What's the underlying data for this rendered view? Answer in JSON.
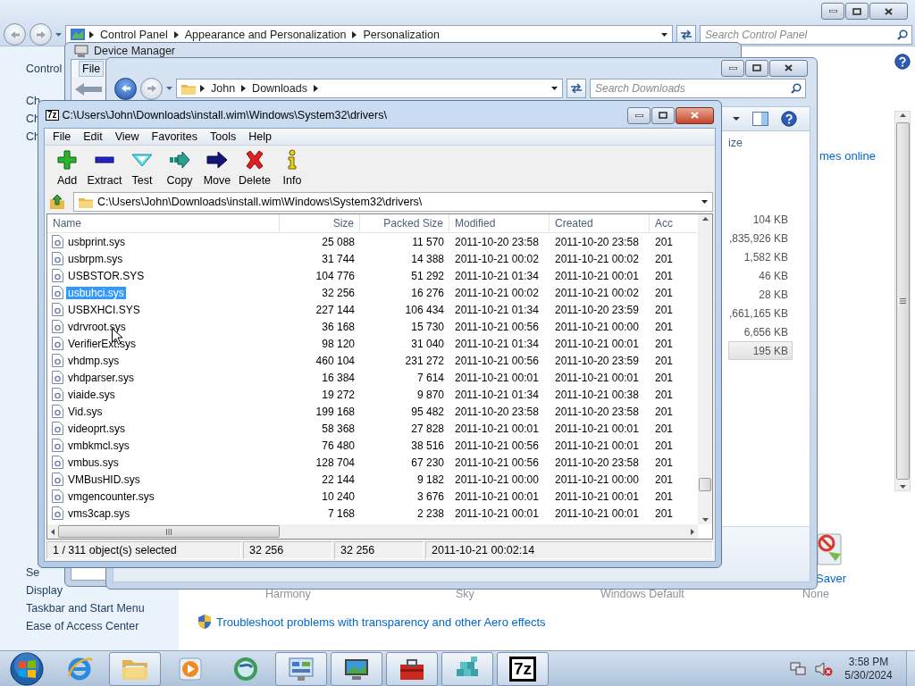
{
  "control_panel": {
    "breadcrumbs": [
      "Control Panel",
      "Appearance and Personalization",
      "Personalization"
    ],
    "search_placeholder": "Search Control Panel",
    "sidebar_top": [
      "Control",
      "Ch",
      "Ch",
      "Ch"
    ],
    "sidebar_bottom": [
      "Se",
      "Display",
      "Taskbar and Start Menu",
      "Ease of Access Center"
    ],
    "online_link": "mes online",
    "saver_label": "Saver",
    "theme_names": [
      "Harmony",
      "Sky",
      "Windows Default",
      "None"
    ],
    "troubleshoot_link": "Troubleshoot problems with transparency and other Aero effects"
  },
  "device_manager": {
    "title": "Device Manager",
    "menu": [
      "File"
    ]
  },
  "downloads": {
    "breadcrumbs": [
      "John",
      "Downloads"
    ],
    "search_placeholder": "Search Downloads",
    "column": "ize",
    "sizes": [
      {
        "text": "104 KB",
        "selected": false
      },
      {
        "text": ",835,926 KB",
        "selected": false
      },
      {
        "text": "1,582 KB",
        "selected": false
      },
      {
        "text": "46 KB",
        "selected": false
      },
      {
        "text": "28 KB",
        "selected": false
      },
      {
        "text": ",661,165 KB",
        "selected": false
      },
      {
        "text": "6,656 KB",
        "selected": false
      },
      {
        "text": "195 KB",
        "selected": true
      }
    ]
  },
  "archive": {
    "logo": "7z",
    "title": "C:\\Users\\John\\Downloads\\install.wim\\Windows\\System32\\drivers\\",
    "menu": [
      "File",
      "Edit",
      "View",
      "Favorites",
      "Tools",
      "Help"
    ],
    "toolbar": [
      {
        "label": "Add",
        "kind": "add"
      },
      {
        "label": "Extract",
        "kind": "extract"
      },
      {
        "label": "Test",
        "kind": "test"
      },
      {
        "label": "Copy",
        "kind": "copy"
      },
      {
        "label": "Move",
        "kind": "move"
      },
      {
        "label": "Delete",
        "kind": "delete"
      },
      {
        "label": "Info",
        "kind": "info"
      }
    ],
    "path": "C:\\Users\\John\\Downloads\\install.wim\\Windows\\System32\\drivers\\",
    "columns": [
      "Name",
      "Size",
      "Packed Size",
      "Modified",
      "Created",
      "Acc"
    ],
    "rows": [
      {
        "cells": [
          "usbprint.sys",
          "25 088",
          "11 570",
          "2011-10-20 23:58",
          "2011-10-20 23:58",
          "201"
        ],
        "selected": false
      },
      {
        "cells": [
          "usbrpm.sys",
          "31 744",
          "14 388",
          "2011-10-21 00:02",
          "2011-10-21 00:02",
          "201"
        ],
        "selected": false
      },
      {
        "cells": [
          "USBSTOR.SYS",
          "104 776",
          "51 292",
          "2011-10-21 01:34",
          "2011-10-21 00:01",
          "201"
        ],
        "selected": false
      },
      {
        "cells": [
          "usbuhci.sys",
          "32 256",
          "16 276",
          "2011-10-21 00:02",
          "2011-10-21 00:02",
          "201"
        ],
        "selected": true
      },
      {
        "cells": [
          "USBXHCI.SYS",
          "227 144",
          "106 434",
          "2011-10-21 01:34",
          "2011-10-20 23:59",
          "201"
        ],
        "selected": false
      },
      {
        "cells": [
          "vdrvroot.sys",
          "36 168",
          "15 730",
          "2011-10-21 00:56",
          "2011-10-21 00:00",
          "201"
        ],
        "selected": false
      },
      {
        "cells": [
          "VerifierExt.sys",
          "98 120",
          "31 040",
          "2011-10-21 01:34",
          "2011-10-21 00:01",
          "201"
        ],
        "selected": false
      },
      {
        "cells": [
          "vhdmp.sys",
          "460 104",
          "231 272",
          "2011-10-21 00:56",
          "2011-10-20 23:59",
          "201"
        ],
        "selected": false
      },
      {
        "cells": [
          "vhdparser.sys",
          "16 384",
          "7 614",
          "2011-10-21 00:01",
          "2011-10-21 00:01",
          "201"
        ],
        "selected": false
      },
      {
        "cells": [
          "viaide.sys",
          "19 272",
          "9 870",
          "2011-10-21 01:34",
          "2011-10-21 00:38",
          "201"
        ],
        "selected": false
      },
      {
        "cells": [
          "Vid.sys",
          "199 168",
          "95 482",
          "2011-10-20 23:58",
          "2011-10-20 23:58",
          "201"
        ],
        "selected": false
      },
      {
        "cells": [
          "videoprt.sys",
          "58 368",
          "27 828",
          "2011-10-21 00:01",
          "2011-10-21 00:01",
          "201"
        ],
        "selected": false
      },
      {
        "cells": [
          "vmbkmcl.sys",
          "76 480",
          "38 516",
          "2011-10-21 00:56",
          "2011-10-21 00:01",
          "201"
        ],
        "selected": false
      },
      {
        "cells": [
          "vmbus.sys",
          "128 704",
          "67 230",
          "2011-10-21 00:56",
          "2011-10-20 23:58",
          "201"
        ],
        "selected": false
      },
      {
        "cells": [
          "VMBusHID.sys",
          "22 144",
          "9 182",
          "2011-10-21 00:00",
          "2011-10-21 00:00",
          "201"
        ],
        "selected": false
      },
      {
        "cells": [
          "vmgencounter.sys",
          "10 240",
          "3 676",
          "2011-10-21 00:01",
          "2011-10-21 00:01",
          "201"
        ],
        "selected": false
      },
      {
        "cells": [
          "vms3cap.sys",
          "7 168",
          "2 238",
          "2011-10-21 00:01",
          "2011-10-21 00:01",
          "201"
        ],
        "selected": false
      }
    ],
    "status": [
      "1 / 311 object(s) selected",
      "32 256",
      "32 256",
      "2011-10-21 00:02:14"
    ]
  },
  "taskbar": {
    "apps": [
      {
        "kind": "browser",
        "running": false
      },
      {
        "kind": "folder",
        "running": true
      },
      {
        "kind": "media",
        "running": false
      },
      {
        "kind": "globe",
        "running": false
      },
      {
        "kind": "control",
        "running": true
      },
      {
        "kind": "monitor",
        "running": true
      },
      {
        "kind": "toolbox",
        "running": true
      },
      {
        "kind": "cubes",
        "running": true
      },
      {
        "kind": "archiver",
        "running": true,
        "logo": "7z"
      }
    ],
    "time": "3:58 PM",
    "date": "5/30/2024"
  }
}
